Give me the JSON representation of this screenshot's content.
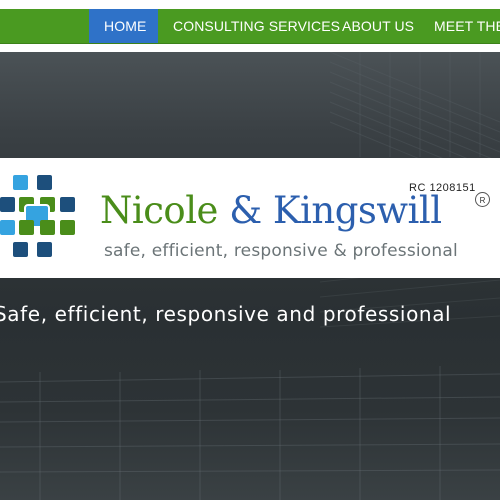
{
  "nav": {
    "items": [
      {
        "label": "HOME",
        "active": true
      },
      {
        "label": "CONSULTING SERVICES",
        "active": false
      },
      {
        "label": "ABOUT US",
        "active": false
      },
      {
        "label": "MEET THE",
        "active": false
      }
    ]
  },
  "logo": {
    "name_part1": "Nicole",
    "name_amp": " & ",
    "name_part2": "Kingswill",
    "tagline": "safe, efficient, responsive & professional",
    "rc_number": "RC 1208151",
    "registered_mark": "R"
  },
  "hero": {
    "tagline": "Safe, efficient, responsive and professional"
  },
  "colors": {
    "nav_green": "#4a9a21",
    "nav_active_blue": "#2f72c8",
    "brand_blue": "#2c5fae",
    "brand_green": "#4a8d1a",
    "logo_dark_blue": "#1d4f7c",
    "logo_light_blue": "#35a3e0"
  },
  "icons": [
    "logo-mark-icon",
    "registered-mark-icon"
  ]
}
